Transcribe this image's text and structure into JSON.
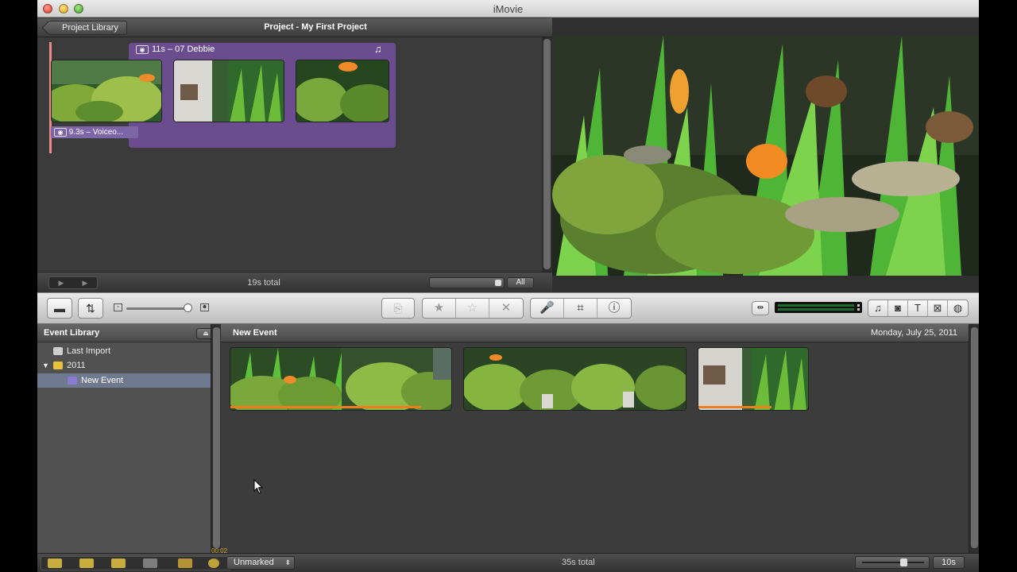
{
  "window": {
    "title": "iMovie"
  },
  "project": {
    "library_button": "Project Library",
    "title": "Project - My First Project",
    "clip_title": "11s – 07 Debbie",
    "voiceover_label": "9.3s – Voiceo...",
    "total": "19s total",
    "zoom_all": "All"
  },
  "event_library": {
    "title": "Event Library",
    "items": [
      {
        "label": "Last Import"
      },
      {
        "label": "2011"
      },
      {
        "label": "New Event"
      }
    ]
  },
  "event_browser": {
    "name": "New Event",
    "date": "Monday, July 25, 2011",
    "total": "35s total"
  },
  "bottom": {
    "filter": "Unmarked",
    "timecode": "00:02",
    "duration": "10s"
  },
  "icons": {
    "camera": "camera-icon",
    "swap": "swap-icon",
    "add": "add-to-project-icon",
    "favorite": "star-filled-icon",
    "unmark": "star-outline-icon",
    "reject": "reject-x-icon",
    "voiceover": "microphone-icon",
    "crop": "crop-icon",
    "info": "info-icon",
    "music": "music-icon",
    "photo": "photo-camera-icon",
    "title": "title-t-icon",
    "transition": "transition-icon",
    "map": "globe-icon"
  }
}
